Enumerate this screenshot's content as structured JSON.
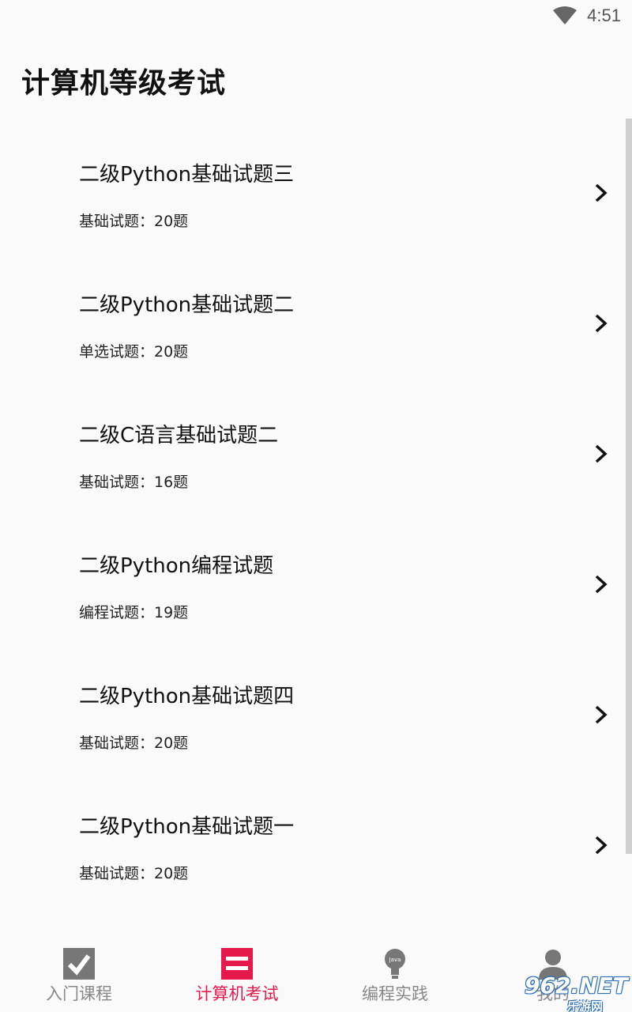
{
  "status_bar": {
    "time": "4:51",
    "wifi_icon": "wifi-icon"
  },
  "header": {
    "title": "计算机等级考试"
  },
  "exams": [
    {
      "title": "二级Python基础试题三",
      "subtitle": "基础试题：20题"
    },
    {
      "title": "二级Python基础试题二",
      "subtitle": "单选试题：20题"
    },
    {
      "title": "二级C语言基础试题二",
      "subtitle": "基础试题：16题"
    },
    {
      "title": "二级Python编程试题",
      "subtitle": "编程试题：19题"
    },
    {
      "title": "二级Python基础试题四",
      "subtitle": "基础试题：20题"
    },
    {
      "title": "二级Python基础试题一",
      "subtitle": "基础试题：20题"
    }
  ],
  "bottom_nav": {
    "tabs": [
      {
        "label": "入门课程",
        "icon": "checkbox-icon",
        "active": false
      },
      {
        "label": "计算机考试",
        "icon": "menu-icon",
        "active": true
      },
      {
        "label": "编程实践",
        "icon": "java-lightbulb-icon",
        "active": false
      },
      {
        "label": "我的",
        "icon": "person-icon",
        "active": false
      }
    ]
  },
  "watermark": {
    "brand": "962.NET",
    "sub": "乐游网"
  },
  "colors": {
    "accent": "#e5194b",
    "inactive": "#888888",
    "background": "#fafafa"
  }
}
